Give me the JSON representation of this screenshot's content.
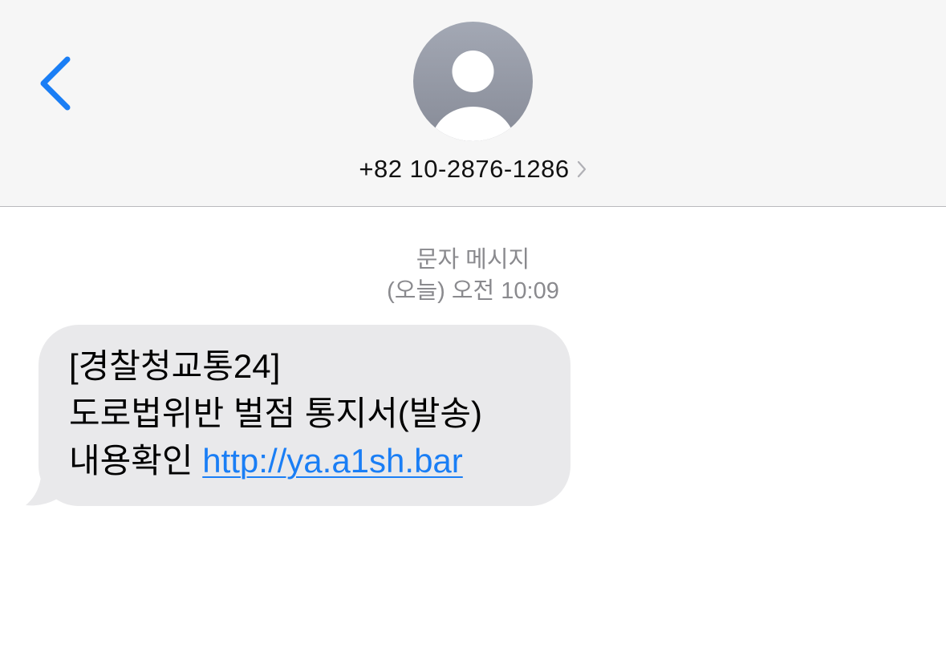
{
  "header": {
    "contact_number": "+82 10-2876-1286",
    "back_icon": "chevron-left-icon",
    "avatar_icon": "person-silhouette-icon",
    "disclosure_icon": "chevron-right-icon"
  },
  "conversation": {
    "message_type": "문자 메시지",
    "timestamp": "(오늘) 오전 10:09"
  },
  "message": {
    "line1": "[경찰청교통24]",
    "line2": "도로법위반 벌점 통지서(발송)",
    "line3_prefix": "내용확인 ",
    "link_text": "http://ya.a1sh.bar"
  },
  "colors": {
    "accent": "#1a7ef5",
    "bubble": "#e9e9eb",
    "header_bg": "#f6f6f6",
    "meta_text": "#8a8a8e"
  }
}
